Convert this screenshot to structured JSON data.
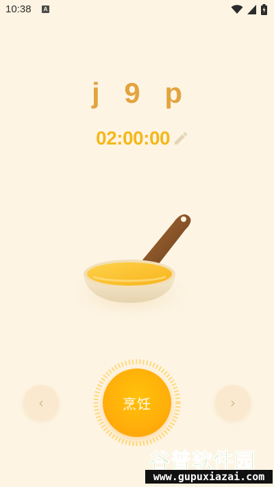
{
  "status_bar": {
    "time": "10:38",
    "app_icon_letter": "A"
  },
  "recipe": {
    "title": "j 9 p",
    "timer": "02:00:00"
  },
  "controls": {
    "prev_glyph": "‹",
    "next_glyph": "›",
    "cook_label": "烹饪"
  },
  "watermark": {
    "brand": "谷普软件园",
    "url": "www.gupuxiazai.com"
  },
  "colors": {
    "background": "#fdf4e3",
    "title": "#e2a43f",
    "timer": "#f4b81d",
    "cook_button": "#ffae0a"
  },
  "icons": [
    "wifi-icon",
    "signal-icon",
    "battery-icon",
    "edit-icon",
    "chevron-left-icon",
    "chevron-right-icon",
    "frying-pan-icon"
  ]
}
